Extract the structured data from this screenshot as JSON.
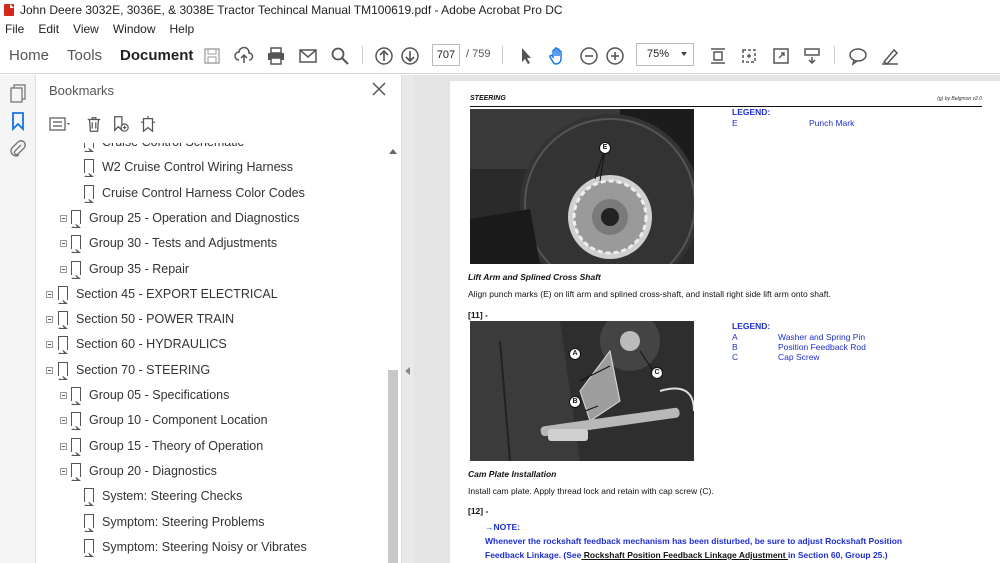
{
  "window": {
    "title": "John Deere 3032E, 3036E, & 3038E Tractor Techincal Manual TM100619.pdf - Adobe Acrobat Pro DC"
  },
  "menu": [
    "File",
    "Edit",
    "View",
    "Window",
    "Help"
  ],
  "toolbar": {
    "tabs": [
      "Home",
      "Tools",
      "Document"
    ],
    "active_tab": "Document",
    "page_current": "707",
    "page_total": "/ 759",
    "zoom": "75%"
  },
  "bookmarks": {
    "title": "Bookmarks",
    "items": [
      {
        "label": "Cruise Control Schematic",
        "level": 3,
        "toggle": false
      },
      {
        "label": "W2 Cruise Control Wiring Harness",
        "level": 3,
        "toggle": false
      },
      {
        "label": "Cruise Control Harness Color Codes",
        "level": 3,
        "toggle": false
      },
      {
        "label": "Group 25 - Operation and Diagnostics",
        "level": 2,
        "toggle": true
      },
      {
        "label": "Group 30 - Tests and Adjustments",
        "level": 2,
        "toggle": true
      },
      {
        "label": "Group 35 - Repair",
        "level": 2,
        "toggle": true
      },
      {
        "label": "Section 45 - EXPORT ELECTRICAL",
        "level": 1,
        "toggle": true
      },
      {
        "label": "Section 50 - POWER TRAIN",
        "level": 1,
        "toggle": true
      },
      {
        "label": "Section 60 - HYDRAULICS",
        "level": 1,
        "toggle": true
      },
      {
        "label": "Section 70 - STEERING",
        "level": 1,
        "toggle": true
      },
      {
        "label": "Group 05 - Specifications",
        "level": 2,
        "toggle": true
      },
      {
        "label": "Group 10 - Component Location",
        "level": 2,
        "toggle": true
      },
      {
        "label": "Group 15 - Theory of Operation",
        "level": 2,
        "toggle": true
      },
      {
        "label": "Group 20 - Diagnostics",
        "level": 2,
        "toggle": true
      },
      {
        "label": "System: Steering Checks",
        "level": 3,
        "toggle": false
      },
      {
        "label": "Symptom: Steering Problems",
        "level": 3,
        "toggle": false
      },
      {
        "label": "Symptom: Steering Noisy or Vibrates",
        "level": 3,
        "toggle": false
      }
    ]
  },
  "document": {
    "header_left": "STEERING",
    "header_right": "(g) by Belgmon v2.0",
    "legend1": {
      "title": "LEGEND:",
      "items": [
        {
          "key": "E",
          "text": "Punch Mark"
        }
      ]
    },
    "caption1": "Lift Arm and Splined Cross Shaft",
    "body1": "Align punch marks (E) on lift arm and splined cross-shaft, and install right side lift arm onto shaft.",
    "step11": "[11] -",
    "legend2": {
      "title": "LEGEND:",
      "items": [
        {
          "key": "A",
          "text": "Washer and Spring Pin"
        },
        {
          "key": "B",
          "text": "Position Feedback Rod"
        },
        {
          "key": "C",
          "text": "Cap Screw"
        }
      ]
    },
    "caption2": "Cam Plate Installation",
    "body2": "Install cam plate. Apply thread lock and retain with cap screw (C).",
    "step12": "[12] -",
    "note_label": "→NOTE:",
    "note_line1": "Whenever the rockshaft feedback mechanism has been disturbed, be sure to adjust Rockshaft Position",
    "note_line2_a": "Feedback Linkage. (See",
    "note_link": " Rockshaft Position Feedback Linkage Adjustment ",
    "note_line2_b": "in Section 60, Group 25.)",
    "callouts": [
      "E",
      "A",
      "B",
      "C"
    ]
  }
}
